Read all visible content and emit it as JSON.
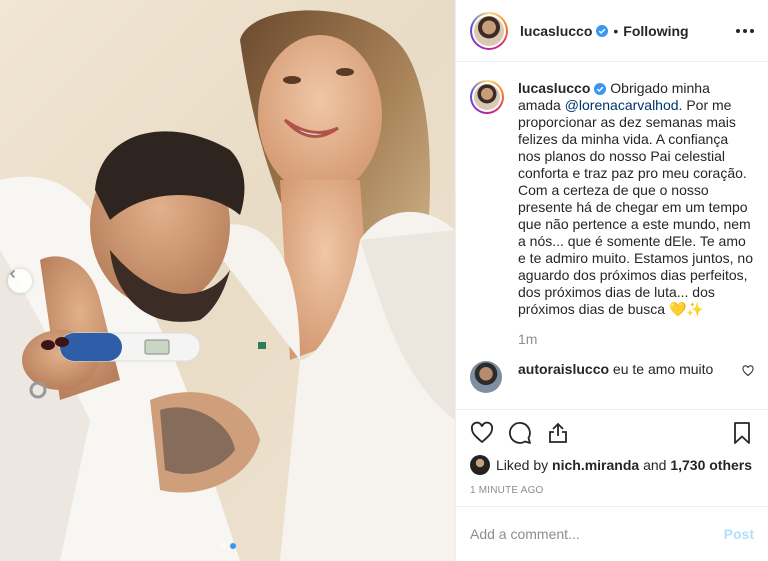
{
  "header": {
    "username": "lucaslucco",
    "verified_icon": "verified-badge-icon",
    "separator": "•",
    "follow_status": "Following",
    "more_icon": "more-options-icon"
  },
  "caption": {
    "username": "lucaslucco",
    "text_before_mention": "Obrigado minha amada ",
    "mention": "@lorenacarvalhod",
    "text_after_mention": ". Por me proporcionar as dez semanas mais felizes da minha vida. A confiança nos planos do nosso Pai celestial conforta e traz paz pro meu coração. Com a certeza de que o nosso presente há de chegar em um tempo que não pertence a este mundo, nem a nós... que é somente dEle. Te amo e te admiro muito. Estamos juntos, no aguardo dos próximos dias perfeitos, dos próximos dias de luta... dos próximos dias de busca 💛✨",
    "time": "1m"
  },
  "reply": {
    "username": "autoraislucco",
    "text": "eu te amo muito"
  },
  "actions": {
    "icons": [
      "heart-icon",
      "comment-icon",
      "share-icon",
      "bookmark-icon"
    ]
  },
  "likes": {
    "prefix": "Liked by",
    "user": "nich.miranda",
    "and": "and",
    "count": "1,730 others"
  },
  "posted_ago": "1 minute ago",
  "comment_box": {
    "placeholder": "Add a comment...",
    "post_label": "Post"
  },
  "photo": {
    "carousel_total": 2,
    "carousel_active": 2
  },
  "colors": {
    "verified": "#3897f0",
    "mention": "#003569",
    "muted": "#8e8e8e",
    "post_disabled": "#b2dffc"
  }
}
